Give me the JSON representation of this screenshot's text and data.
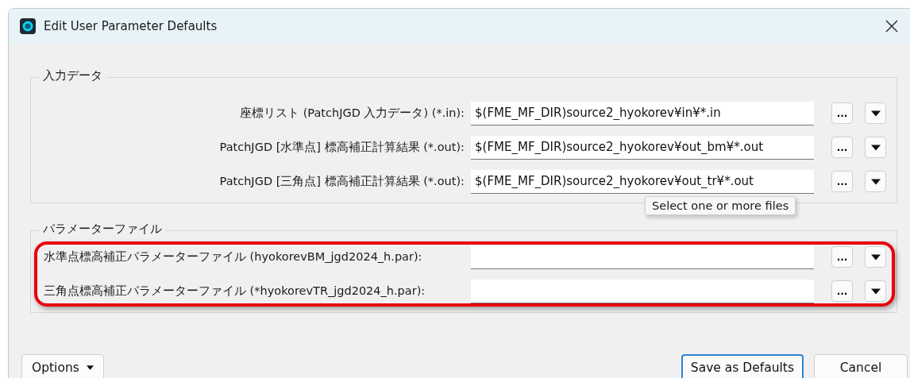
{
  "window": {
    "title": "Edit User Parameter Defaults"
  },
  "groups": [
    {
      "title": "入力データ",
      "kind": "aligned",
      "highlighted": false,
      "rows": [
        {
          "label": "座標リスト (PatchJGD 入力データ) (*.in):",
          "value": "$(FME_MF_DIR)source2_hyokorev¥in¥*.in",
          "browse": "..."
        },
        {
          "label": "PatchJGD [水準点] 標高補正計算結果 (*.out):",
          "value": "$(FME_MF_DIR)source2_hyokorev¥out_bm¥*.out",
          "browse": "..."
        },
        {
          "label": "PatchJGD [三角点] 標高補正計算結果 (*.out):",
          "value": "$(FME_MF_DIR)source2_hyokorev¥out_tr¥*.out",
          "browse": "..."
        }
      ]
    },
    {
      "title": "パラメーターファイル",
      "kind": "plain",
      "highlighted": true,
      "rows": [
        {
          "label": "水準点標高補正パラメーターファイル (hyokorevBM_jgd2024_h.par):",
          "browse": "..."
        },
        {
          "label": "三角点標高補正パラメーターファイル (*hyokorevTR_jgd2024_h.par):",
          "browse": "..."
        }
      ]
    }
  ],
  "tooltip": "Select one or more files",
  "options_button": "Options",
  "buttons": [
    {
      "label": "Save as Defaults",
      "focused": true
    },
    {
      "label": "Cancel",
      "focused": false
    }
  ]
}
